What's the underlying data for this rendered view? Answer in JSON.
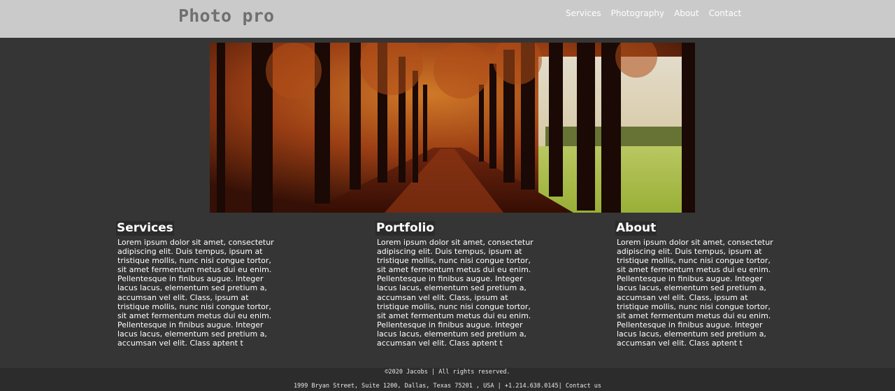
{
  "header": {
    "brand": "Photo pro",
    "nav": [
      "Services",
      "Photography",
      "About",
      "Contact"
    ]
  },
  "hero": {
    "description": ""
  },
  "columns": [
    {
      "title": "Services",
      "text": "Lorem ipsum dolor sit amet, consectetur adipiscing elit. Duis tempus, ipsum at tristique mollis, nunc nisi congue tortor, sit amet fermentum metus dui eu enim. Pellentesque in finibus augue. Integer lacus lacus, elementum sed pretium a, accumsan vel elit. Class, ipsum at tristique mollis, nunc nisi congue tortor, sit amet fermentum metus dui eu enim. Pellentesque in finibus augue. Integer lacus lacus, elementum sed pretium a, accumsan vel elit. Class aptent t"
    },
    {
      "title": "Portfolio",
      "text": "Lorem ipsum dolor sit amet, consectetur adipiscing elit. Duis tempus, ipsum at tristique mollis, nunc nisi congue tortor, sit amet fermentum metus dui eu enim. Pellentesque in finibus augue. Integer lacus lacus, elementum sed pretium a, accumsan vel elit. Class, ipsum at tristique mollis, nunc nisi congue tortor, sit amet fermentum metus dui eu enim. Pellentesque in finibus augue. Integer lacus lacus, elementum sed pretium a, accumsan vel elit. Class aptent t"
    },
    {
      "title": "About",
      "text": "Lorem ipsum dolor sit amet, consectetur adipiscing elit. Duis tempus, ipsum at tristique mollis, nunc nisi congue tortor, sit amet fermentum metus dui eu enim. Pellentesque in finibus augue. Integer lacus lacus, elementum sed pretium a, accumsan vel elit. Class, ipsum at tristique mollis, nunc nisi congue tortor, sit amet fermentum metus dui eu enim. Pellentesque in finibus augue. Integer lacus lacus, elementum sed pretium a, accumsan vel elit. Class aptent t"
    }
  ],
  "footer": {
    "copyright": "©2020 Jacobs | All rights reserved.",
    "address": "1999 Bryan Street, Suite 1200, Dallas, Texas 75201 , USA | +1.214.638.0145| Contact us"
  },
  "colors": {
    "header_bg": "#cacaca",
    "page_bg": "#353535",
    "footer_bg": "#2c2c2c",
    "brand_text": "#707070"
  }
}
